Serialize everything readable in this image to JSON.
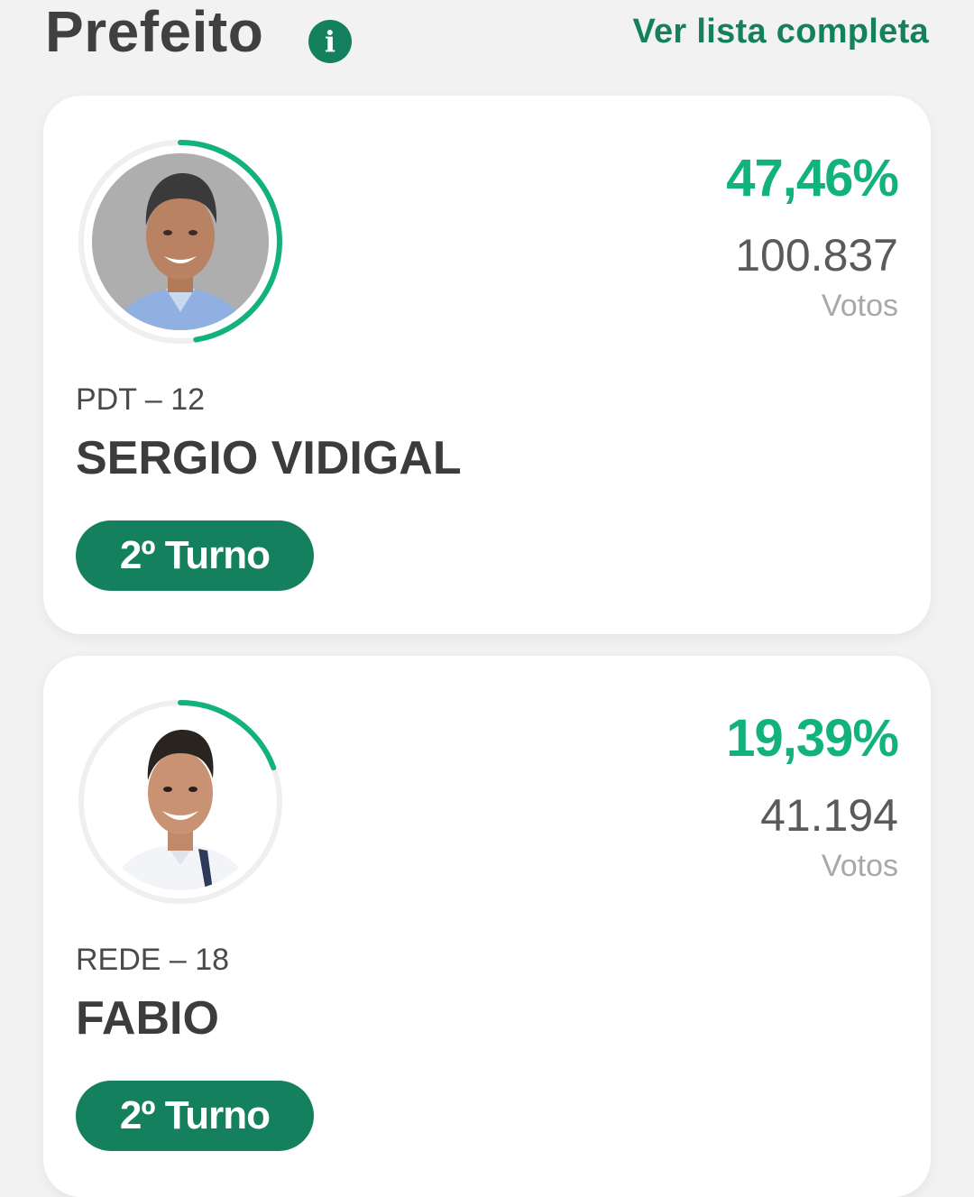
{
  "header": {
    "title": "Prefeito",
    "info_icon": "info-icon",
    "view_all_link": "Ver lista completa"
  },
  "colors": {
    "accent": "#14805d",
    "percent": "#12b27f",
    "background": "#f2f2f2"
  },
  "candidates": [
    {
      "percent_text": "47,46%",
      "percent_value": 47.46,
      "votes": "100.837",
      "votes_label": "Votos",
      "party": "PDT – 12",
      "name": "SERGIO VIDIGAL",
      "badge": "2º Turno",
      "photo": "candidate-photo"
    },
    {
      "percent_text": "19,39%",
      "percent_value": 19.39,
      "votes": "41.194",
      "votes_label": "Votos",
      "party": "REDE – 18",
      "name": "FABIO",
      "badge": "2º Turno",
      "photo": "candidate-photo"
    }
  ]
}
